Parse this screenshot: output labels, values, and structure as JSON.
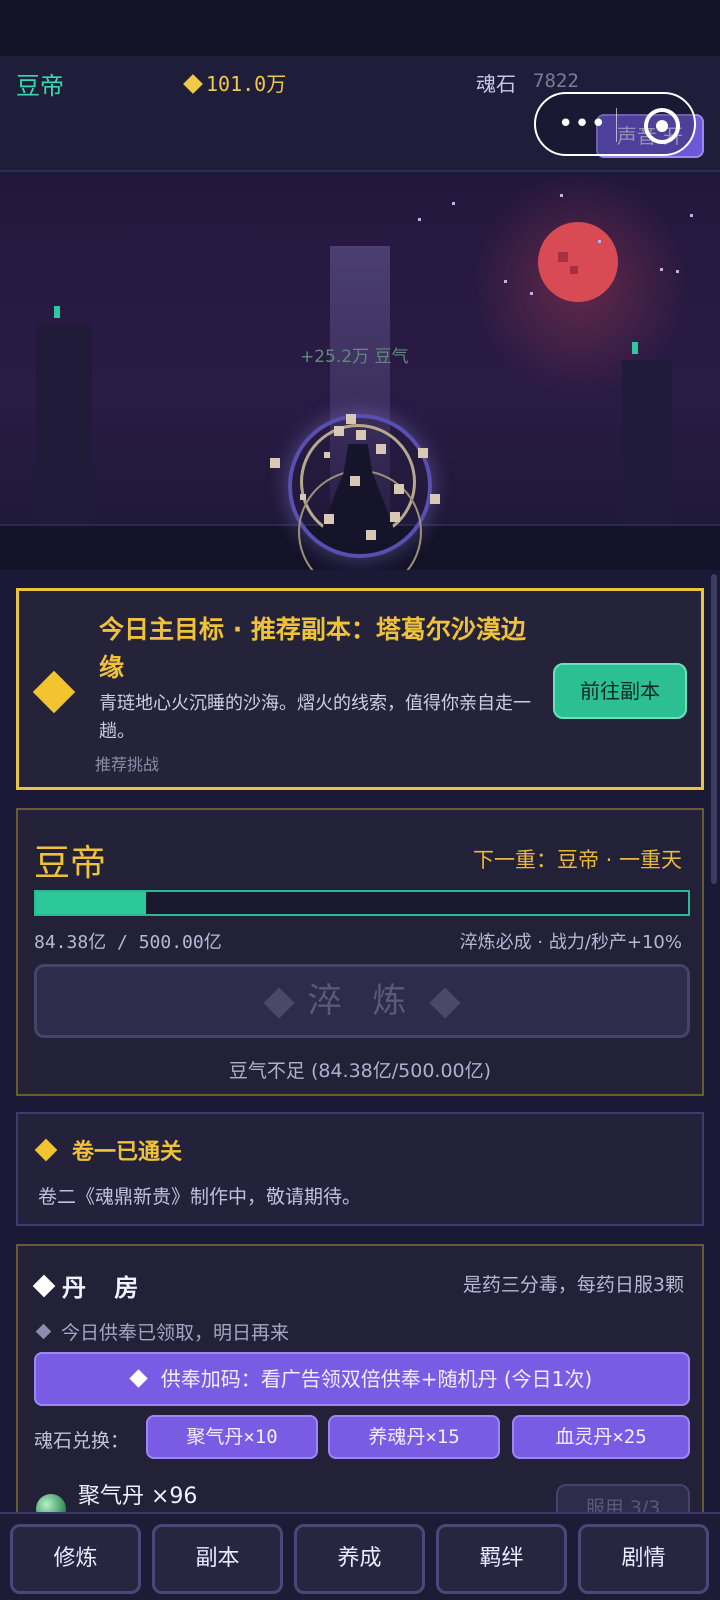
{
  "header": {
    "player_name": "豆帝",
    "beans": "101.0万",
    "soul_stone_label": "魂石",
    "soul_stone_value": "7822",
    "sound_toggle": "声音 开"
  },
  "scene": {
    "gain_text": "+25.2万 豆气"
  },
  "quest": {
    "title": "今日主目标 · 推荐副本：塔葛尔沙漠边缘",
    "description": "青琏地心火沉睡的沙海。熠火的线索，值得你亲自走一趟。",
    "hint": "推荐挑战",
    "go_button": "前往副本"
  },
  "realm": {
    "name": "豆帝",
    "next_label": "下一重：豆帝 · 一重天",
    "progress_text": "84.38亿 / 500.00亿",
    "progress_fraction": 0.169,
    "bonus_text": "淬炼必成 · 战力/秒产+10%",
    "refine_button": "淬 炼",
    "insufficient_text": "豆气不足 (84.38亿/500.00亿)"
  },
  "volume": {
    "title": "卷一已通关",
    "description": "卷二《魂鼎新贵》制作中，敬请期待。"
  },
  "alchemy": {
    "title": "丹 房",
    "tip": "是药三分毒，每药日服3颗",
    "status": "今日供奉已领取，明日再来",
    "ad_button": "供奉加码：看广告领双倍供奉+随机丹 (今日1次)",
    "exchange_label": "魂石兑换：",
    "exchange_options": [
      "聚气丹×10",
      "养魂丹×15",
      "血灵丹×25"
    ],
    "pill_name": "聚气丹 ×96",
    "take_button": "服用 3/3"
  },
  "nav": {
    "items": [
      "修炼",
      "副本",
      "养成",
      "羁绊",
      "剧情"
    ]
  },
  "colors": {
    "accent_gold": "#f0c23a",
    "accent_green": "#2cc79b",
    "accent_purple": "#7a5ce4",
    "background": "#1b1a36"
  }
}
